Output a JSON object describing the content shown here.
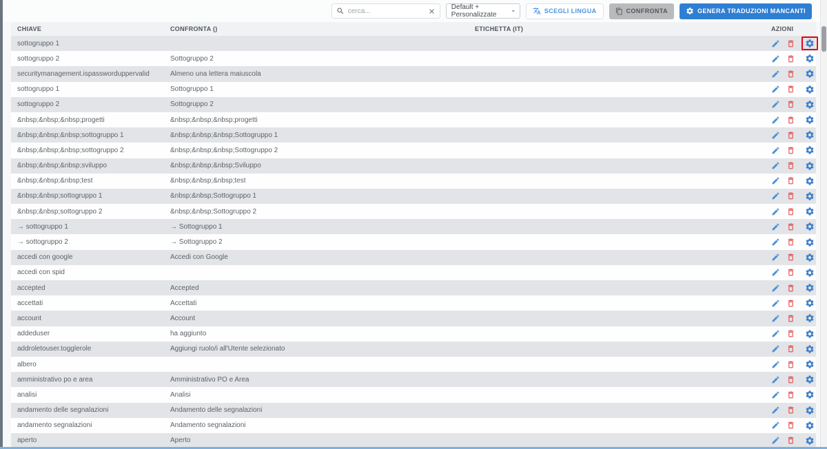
{
  "toolbar": {
    "search": {
      "placeholder": "cerca...",
      "value": ""
    },
    "dictionary_select": {
      "value": "Default + Personalizzate"
    },
    "buttons": {
      "scegli_lingua": "SCEGLI LINGUA",
      "confronta": "CONFRONTA",
      "genera": "GENERA TRADUZIONI MANCANTI"
    }
  },
  "table": {
    "columns": [
      "CHIAVE",
      "CONFRONTA ()",
      "ETICHETTA (IT)",
      "AZIONI"
    ],
    "rows": [
      {
        "chiave": "sottogruppo 1",
        "confronta": "",
        "etichetta": "",
        "highlighted": true
      },
      {
        "chiave": "sottogruppo 2",
        "confronta": "Sottogruppo 2",
        "etichetta": ""
      },
      {
        "chiave": "securitymanagement.ispassworduppervalid",
        "confronta": "Almeno una lettera maiuscola",
        "etichetta": ""
      },
      {
        "chiave": "sottogruppo 1",
        "confronta": "Sottogruppo 1",
        "etichetta": ""
      },
      {
        "chiave": "sottogruppo 2",
        "confronta": "Sottogruppo 2",
        "etichetta": ""
      },
      {
        "chiave": "&nbsp;&nbsp;&nbsp;progetti",
        "confronta": "&nbsp;&nbsp;&nbsp;progetti",
        "etichetta": ""
      },
      {
        "chiave": "&nbsp;&nbsp;&nbsp;sottogruppo 1",
        "confronta": "&nbsp;&nbsp;&nbsp;Sottogruppo 1",
        "etichetta": ""
      },
      {
        "chiave": "&nbsp;&nbsp;&nbsp;sottogruppo 2",
        "confronta": "&nbsp;&nbsp;&nbsp;Sottogruppo 2",
        "etichetta": ""
      },
      {
        "chiave": "&nbsp;&nbsp;&nbsp;sviluppo",
        "confronta": "&nbsp;&nbsp;&nbsp;Sviluppo",
        "etichetta": ""
      },
      {
        "chiave": "&nbsp;&nbsp;&nbsp;test",
        "confronta": "&nbsp;&nbsp;&nbsp;test",
        "etichetta": ""
      },
      {
        "chiave": "&nbsp;&nbsp;sottogruppo 1",
        "confronta": "&nbsp;&nbsp;Sottogruppo 1",
        "etichetta": ""
      },
      {
        "chiave": "&nbsp;&nbsp;sottogruppo 2",
        "confronta": "&nbsp;&nbsp;Sottogruppo 2",
        "etichetta": ""
      },
      {
        "chiave": "→ sottogruppo 1",
        "confronta": "→ Sottogruppo 1",
        "etichetta": ""
      },
      {
        "chiave": "→ sottogruppo 2",
        "confronta": "→ Sottogruppo 2",
        "etichetta": ""
      },
      {
        "chiave": "accedi con google",
        "confronta": "Accedi con Google",
        "etichetta": ""
      },
      {
        "chiave": "accedi con spid",
        "confronta": "",
        "etichetta": ""
      },
      {
        "chiave": "accepted",
        "confronta": "Accepted",
        "etichetta": ""
      },
      {
        "chiave": "accettati",
        "confronta": "Accettati",
        "etichetta": ""
      },
      {
        "chiave": "account",
        "confronta": "Account",
        "etichetta": ""
      },
      {
        "chiave": "addeduser",
        "confronta": "ha aggiunto",
        "etichetta": ""
      },
      {
        "chiave": "addroletouser.togglerole",
        "confronta": "Aggiungi ruolo/i all'Utente selezionato",
        "etichetta": ""
      },
      {
        "chiave": "albero",
        "confronta": "",
        "etichetta": ""
      },
      {
        "chiave": "amministrativo po e area",
        "confronta": "Amministrativo PO e Area",
        "etichetta": ""
      },
      {
        "chiave": "analisi",
        "confronta": "Analisi",
        "etichetta": ""
      },
      {
        "chiave": "andamento delle segnalazioni",
        "confronta": "Andamento delle segnalazioni",
        "etichetta": ""
      },
      {
        "chiave": "andamento segnalazioni",
        "confronta": "Andamento segnalazioni",
        "etichetta": ""
      },
      {
        "chiave": "aperto",
        "confronta": "Aperto",
        "etichetta": ""
      }
    ]
  },
  "colors": {
    "accent_blue": "#2e7ed3",
    "icon_edit_blue": "#4a90d9",
    "icon_delete_red": "#dd4b4b",
    "icon_gear_blue": "#3d7ec9",
    "highlight_red": "#e30613",
    "row_stripe_gray": "#e2e4e7"
  }
}
